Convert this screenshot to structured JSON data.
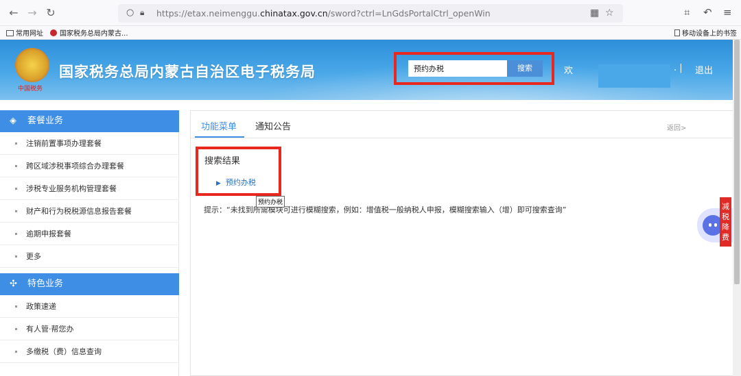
{
  "browser": {
    "url_prefix": "https://etax.neimenggu.",
    "url_domain": "chinatax.gov.cn",
    "url_suffix": "/sword?ctrl=LnGdsPortalCtrl_openWin",
    "bookmarks": [
      "常用网址",
      "国家税务总局内蒙古..."
    ],
    "mobile_bookmarks": "移动设备上的书签"
  },
  "header": {
    "title": "国家税务总局内蒙古自治区电子税务局",
    "emblem_caption": "中国税务",
    "search_value": "预约办税",
    "search_button": "搜索",
    "welcome": "欢",
    "separator": ". |",
    "logout": "退出"
  },
  "sidebar": {
    "sections": [
      {
        "title": "套餐业务",
        "items": [
          "注销前置事项办理套餐",
          "跨区域涉税事项综合办理套餐",
          "涉税专业服务机构管理套餐",
          "财产和行为税税源信息报告套餐",
          "逾期申报套餐",
          "更多"
        ]
      },
      {
        "title": "特色业务",
        "items": [
          "政策速递",
          "有人管·帮您办",
          "多缴税（费）信息查询"
        ]
      }
    ]
  },
  "main": {
    "tabs": [
      "功能菜单",
      "通知公告"
    ],
    "active_tab": 0,
    "back": "返回>",
    "result_title": "搜索结果",
    "result_item": "预约办税",
    "tooltip": "预约办税",
    "hint": "提示：“未找到所需模块可进行模糊搜索，例如：增值税一般纳税人申报，模糊搜索输入（增）即可搜索查询”"
  },
  "widgets": {
    "promo": "减税降费"
  },
  "colors": {
    "accent": "#3d8ee4",
    "highlight": "#e8281f",
    "banner": "#2d8fd9"
  }
}
